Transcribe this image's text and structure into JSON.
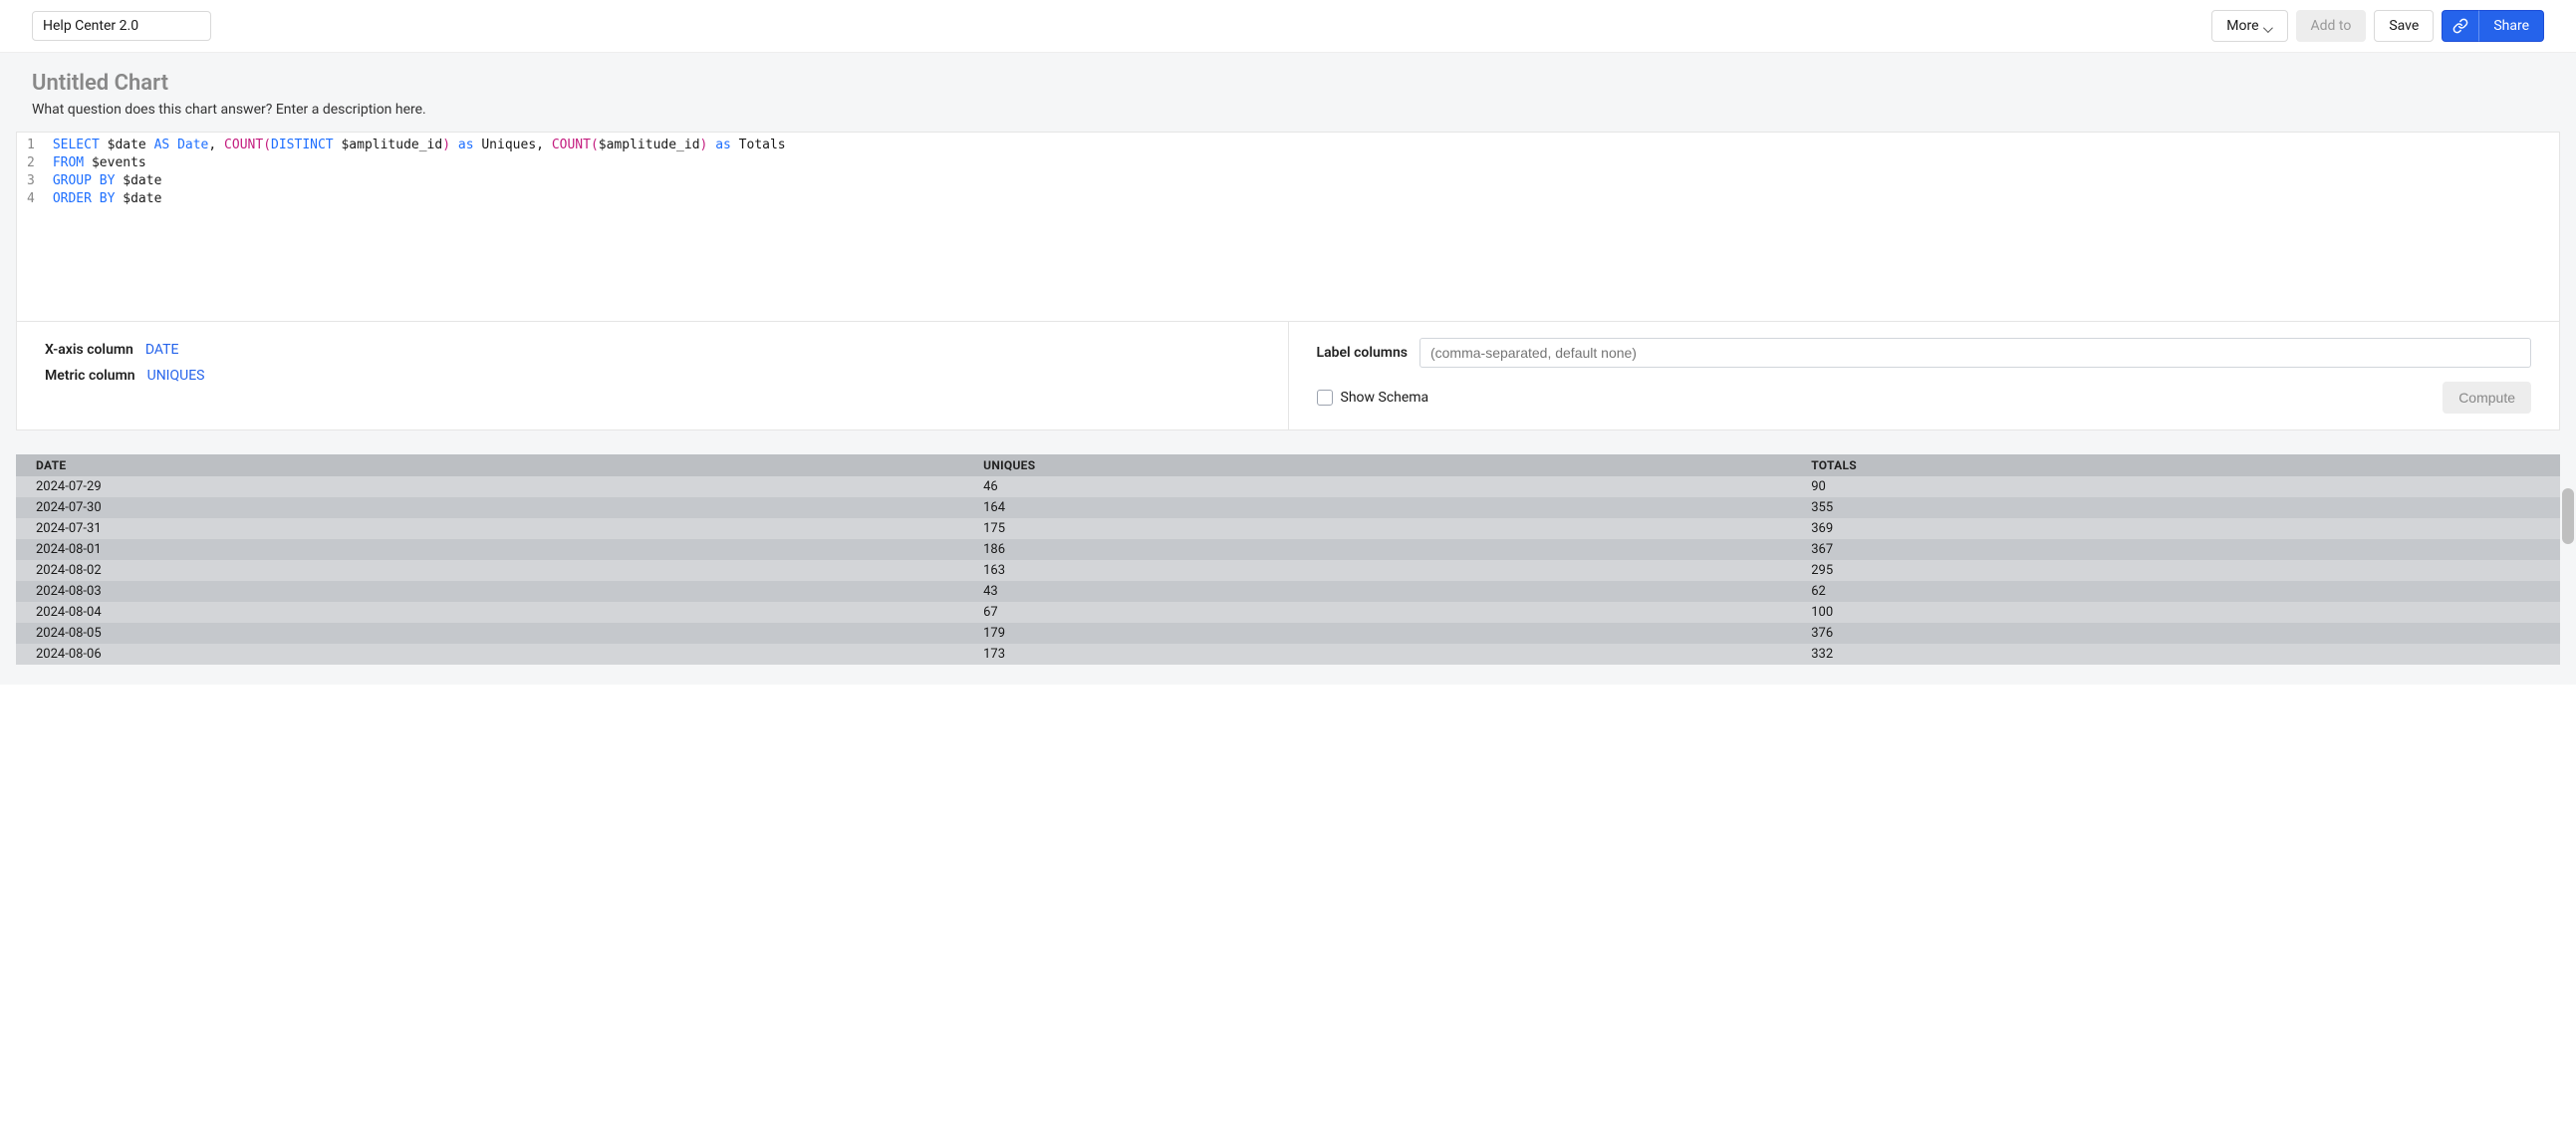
{
  "topbar": {
    "project_name": "Help Center 2.0",
    "more_label": "More",
    "add_to_label": "Add to",
    "save_label": "Save",
    "share_label": "Share"
  },
  "chart": {
    "title": "Untitled Chart",
    "description": "What question does this chart answer? Enter a description here."
  },
  "sql_lines": [
    [
      {
        "t": "SELECT",
        "c": "kw"
      },
      {
        "t": " $date ",
        "c": ""
      },
      {
        "t": "AS",
        "c": "kw"
      },
      {
        "t": " ",
        "c": ""
      },
      {
        "t": "Date",
        "c": "kw"
      },
      {
        "t": ", ",
        "c": ""
      },
      {
        "t": "COUNT",
        "c": "fn"
      },
      {
        "t": "(",
        "c": "paren"
      },
      {
        "t": "DISTINCT",
        "c": "kw"
      },
      {
        "t": " $amplitude_id",
        "c": ""
      },
      {
        "t": ")",
        "c": "paren"
      },
      {
        "t": " ",
        "c": ""
      },
      {
        "t": "as",
        "c": "as"
      },
      {
        "t": " Uniques, ",
        "c": ""
      },
      {
        "t": "COUNT",
        "c": "fn"
      },
      {
        "t": "(",
        "c": "paren"
      },
      {
        "t": "$amplitude_id",
        "c": ""
      },
      {
        "t": ")",
        "c": "paren"
      },
      {
        "t": " ",
        "c": ""
      },
      {
        "t": "as",
        "c": "as"
      },
      {
        "t": " Totals",
        "c": ""
      }
    ],
    [
      {
        "t": "FROM",
        "c": "kw"
      },
      {
        "t": " $events",
        "c": ""
      }
    ],
    [
      {
        "t": "GROUP",
        "c": "kw"
      },
      {
        "t": " ",
        "c": ""
      },
      {
        "t": "BY",
        "c": "kw"
      },
      {
        "t": " $date",
        "c": ""
      }
    ],
    [
      {
        "t": "ORDER",
        "c": "kw"
      },
      {
        "t": " ",
        "c": ""
      },
      {
        "t": "BY",
        "c": "kw"
      },
      {
        "t": " $date",
        "c": ""
      }
    ]
  ],
  "config": {
    "xaxis_label": "X-axis column",
    "xaxis_value": "DATE",
    "metric_label": "Metric column",
    "metric_value": "UNIQUES",
    "label_columns_label": "Label columns",
    "label_columns_placeholder": "(comma-separated, default none)",
    "show_schema_label": "Show Schema",
    "compute_label": "Compute"
  },
  "table": {
    "headers": [
      "DATE",
      "UNIQUES",
      "TOTALS"
    ],
    "rows": [
      [
        "2024-07-29",
        "46",
        "90"
      ],
      [
        "2024-07-30",
        "164",
        "355"
      ],
      [
        "2024-07-31",
        "175",
        "369"
      ],
      [
        "2024-08-01",
        "186",
        "367"
      ],
      [
        "2024-08-02",
        "163",
        "295"
      ],
      [
        "2024-08-03",
        "43",
        "62"
      ],
      [
        "2024-08-04",
        "67",
        "100"
      ],
      [
        "2024-08-05",
        "179",
        "376"
      ],
      [
        "2024-08-06",
        "173",
        "332"
      ]
    ]
  }
}
